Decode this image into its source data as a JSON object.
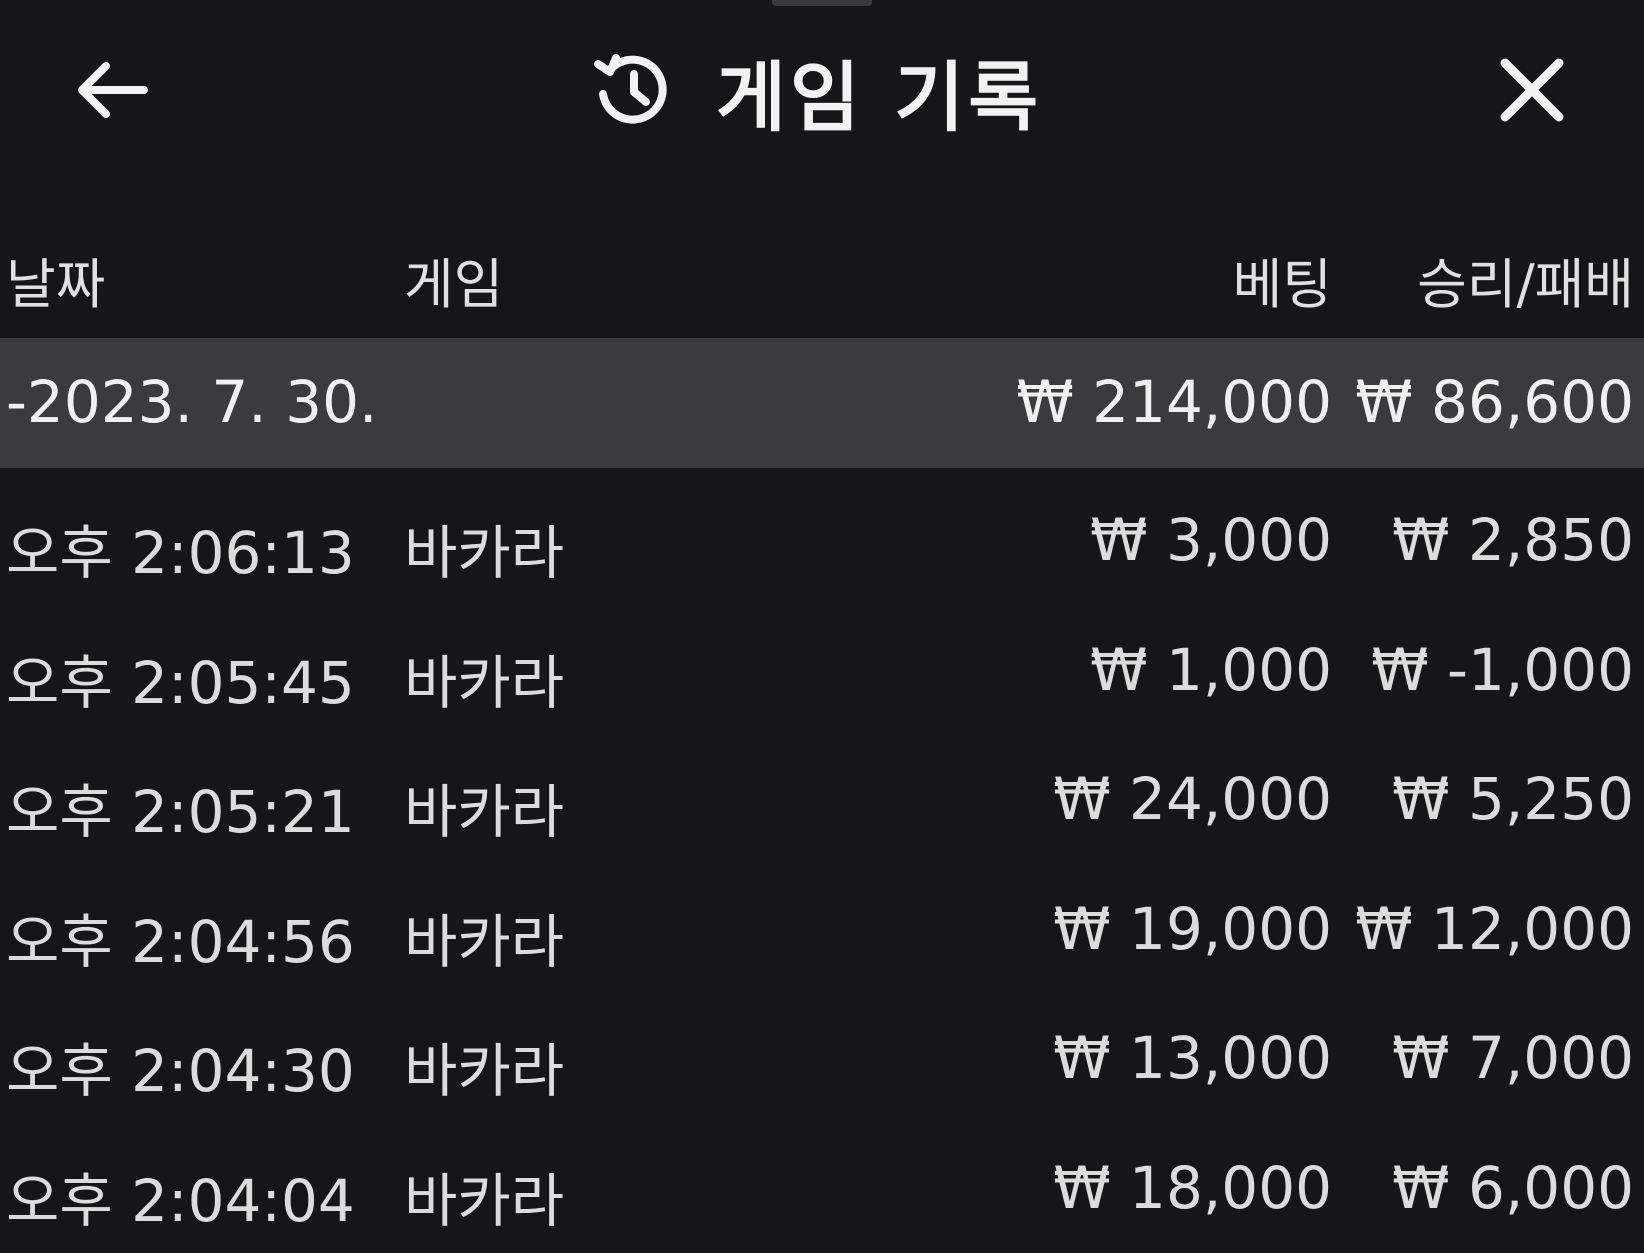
{
  "header": {
    "title": "게임 기록",
    "back_icon": "arrow-left-icon",
    "history_icon": "history-clock-icon",
    "close_icon": "close-icon"
  },
  "columns": {
    "date": "날짜",
    "game": "게임",
    "bet": "베팅",
    "win_loss": "승리/패배"
  },
  "summary": {
    "date": "-2023. 7. 30.",
    "bet": "₩ 214,000",
    "win_loss": "₩ 86,600"
  },
  "rows": [
    {
      "time": "오후 2:06:13",
      "game": "바카라",
      "bet": "₩ 3,000",
      "win_loss": "₩ 2,850"
    },
    {
      "time": "오후 2:05:45",
      "game": "바카라",
      "bet": "₩ 1,000",
      "win_loss": "₩ -1,000"
    },
    {
      "time": "오후 2:05:21",
      "game": "바카라",
      "bet": "₩ 24,000",
      "win_loss": "₩ 5,250"
    },
    {
      "time": "오후 2:04:56",
      "game": "바카라",
      "bet": "₩ 19,000",
      "win_loss": "₩ 12,000"
    },
    {
      "time": "오후 2:04:30",
      "game": "바카라",
      "bet": "₩ 13,000",
      "win_loss": "₩ 7,000"
    },
    {
      "time": "오후 2:04:04",
      "game": "바카라",
      "bet": "₩ 18,000",
      "win_loss": "₩ 6,000"
    }
  ]
}
